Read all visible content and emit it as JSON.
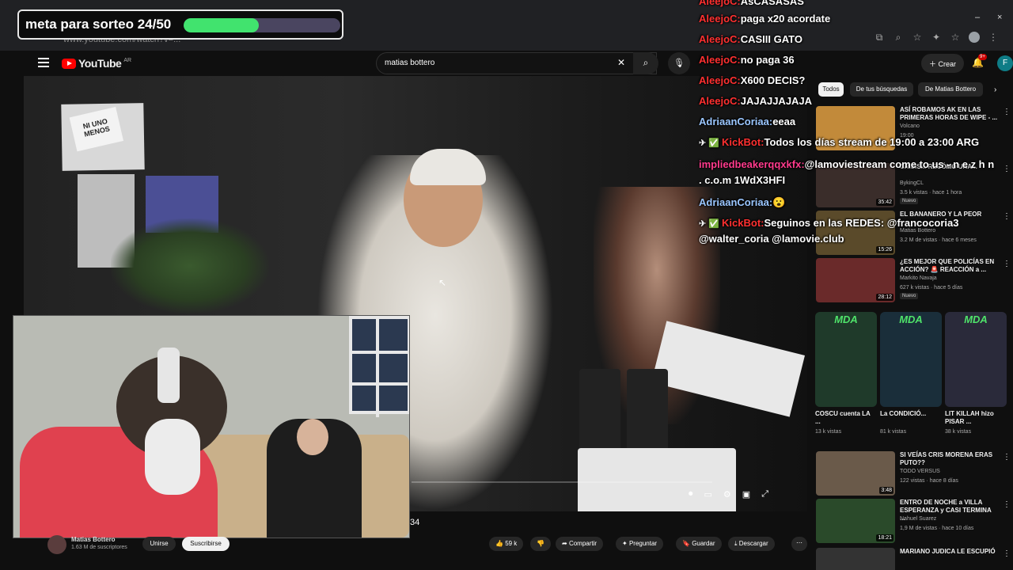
{
  "meta": {
    "label": "meta para sorteo 24/50",
    "progress": 0.48
  },
  "browser": {
    "url": "www.youtube.com/watch?v=...",
    "minimize": "–",
    "close": "×"
  },
  "header": {
    "logo_text": "YouTube",
    "logo_region": "AR",
    "search_value": "matias bottero",
    "create_label": "Crear",
    "notif_count": "9+",
    "avatar_letter": "F"
  },
  "player": {
    "timestamp": "34"
  },
  "channel": {
    "name": "Matias Bottero",
    "subs": "1.63 M de suscriptores",
    "join": "Unirse",
    "subscribe": "Suscribirse"
  },
  "actions": {
    "likes": "59 k",
    "share": "Compartir",
    "ask": "Preguntar",
    "save": "Guardar",
    "download": "Descargar"
  },
  "chat": [
    {
      "user": "AleejoC:",
      "msg": "AsCASASAS",
      "color": "red"
    },
    {
      "user": "AleejoC:",
      "msg": "paga x20 acordate",
      "color": "red"
    },
    {
      "user": "AleejoC:",
      "msg": "CASIII GATO",
      "color": "red"
    },
    {
      "user": "AleejoC:",
      "msg": "no paga 36",
      "color": "red"
    },
    {
      "user": "AleejoC:",
      "msg": "X600 DECIS?",
      "color": "red"
    },
    {
      "user": "AleejoC:",
      "msg": "JAJAJJAJAJA",
      "color": "red"
    },
    {
      "user": "AdriaanCoriaa:",
      "msg": "eeaa",
      "color": "blue"
    },
    {
      "user": "KickBot:",
      "msg": "Todos los días stream de 19:00 a 23:00 ARG",
      "color": "bot"
    },
    {
      "user": "impliedbeakerqqxkfx:",
      "msg": "@lamoviestream come to us - n e z h n",
      "color": "pink"
    },
    {
      "user": "",
      "msg": ". c.o.m 1WdX3HFI",
      "color": "pink"
    },
    {
      "user": "AdriaanCoriaa:",
      "msg": "😮",
      "color": "blue"
    },
    {
      "user": "KickBot:",
      "msg": "Seguinos en las REDES: @francocoria3",
      "color": "bot"
    },
    {
      "user": "",
      "msg": "@walter_coria @lamovie.club",
      "color": "bot"
    }
  ],
  "chips": [
    "Todos",
    "De tus búsquedas",
    "De Matias Bottero"
  ],
  "recs": [
    {
      "title": "ASÍ ROBAMOS AK EN LAS PRIMERAS HORAS DE WIPE - ...",
      "channel": "Volcano",
      "meta": "19:00",
      "new": "",
      "dur": "",
      "color": "#c28a3a"
    },
    {
      "title": "CRISIS... RECÓMO UNA...",
      "channel": "BykingCL",
      "meta": "3.5 k vistas · hace 1 hora",
      "new": "Nuevo",
      "dur": "35:42",
      "color": "#3a2d2a"
    },
    {
      "title": "EL BANANERO Y LA PEOR",
      "channel": "Matias Bottero",
      "meta": "3.2 M de vistas · hace 6 meses",
      "new": "",
      "dur": "15:26",
      "color": "#5a4a2a"
    },
    {
      "title": "¿ES MEJOR QUE POLICÍAS EN ACCIÓN? 🚨 REACCIÓN a ...",
      "channel": "Markito Navaja",
      "meta": "627 k vistas · hace 5 días",
      "new": "Nuevo",
      "dur": "28:12",
      "color": "#6a2a2a"
    },
    {
      "title": "SI VEÍAS CRIS MORENA ERAS PUTO??",
      "channel": "TODO VERSUS",
      "meta": "122 vistas · hace 8 días",
      "new": "",
      "dur": "3:48",
      "color": "#6a5a4a"
    },
    {
      "title": "ENTRO DE NOCHE a VILLA ESPERANZA y CASI TERMINA ...",
      "channel": "Nahuel Suarez",
      "meta": "1,9 M de vistas · hace 10 días",
      "new": "",
      "dur": "18:21",
      "color": "#2a4a2a"
    },
    {
      "title": "MARIANO JUDICA LE ESCUPIÓ",
      "channel": "",
      "meta": "",
      "new": "",
      "dur": "",
      "color": "#333"
    }
  ],
  "shorts": [
    {
      "label": "MDA",
      "title": "COSCU cuenta LA ...",
      "views": "13 k vistas"
    },
    {
      "label": "MDA",
      "title": "La CONDICIÓ...",
      "views": "81 k vistas"
    },
    {
      "label": "MDA",
      "title": "LIT KILLAH hizo PISAR ...",
      "views": "38 k vistas"
    }
  ],
  "colors": {
    "meta_fill": "#41e36e",
    "chat_red": "#ff3030",
    "chat_blue": "#9ac6ff",
    "chat_pink": "#ff3a8c",
    "yt_red": "#ff0000",
    "mda_green": "#4fe36a"
  }
}
